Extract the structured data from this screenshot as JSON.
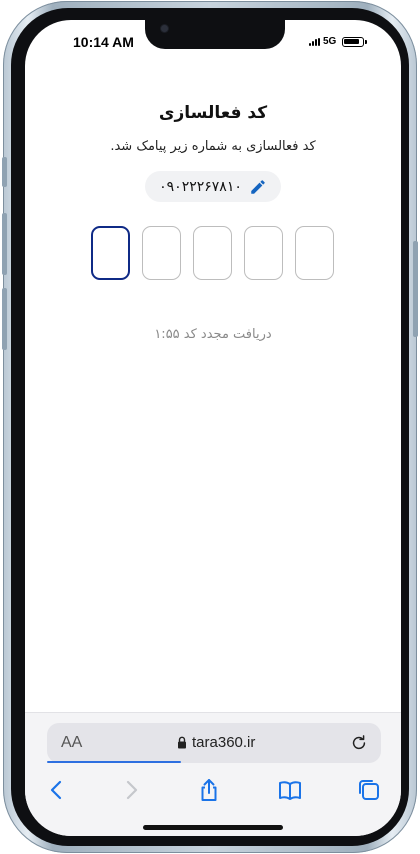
{
  "status_bar": {
    "time": "10:14 AM",
    "network": "5G"
  },
  "page": {
    "title": "کد فعالسازی",
    "subtitle": "کد فعالسازی به شماره زیر پیامک شد.",
    "phone_number": "۰۹۰۲۲۲۶۷۸۱۰",
    "edit_icon": "pencil-icon",
    "otp_digits": [
      "",
      "",
      "",
      "",
      ""
    ],
    "resend_text": "دریافت مجدد کد ۱:۵۵"
  },
  "browser": {
    "text_size_label": "AA",
    "url": "tara360.ir",
    "icons": [
      "lock-icon",
      "reload-icon",
      "back-icon",
      "forward-icon",
      "share-icon",
      "bookmarks-icon",
      "tabs-icon"
    ]
  },
  "colors": {
    "accent": "#0f2a86",
    "link_blue": "#2d6fe0",
    "edit_icon": "#1565c0"
  }
}
